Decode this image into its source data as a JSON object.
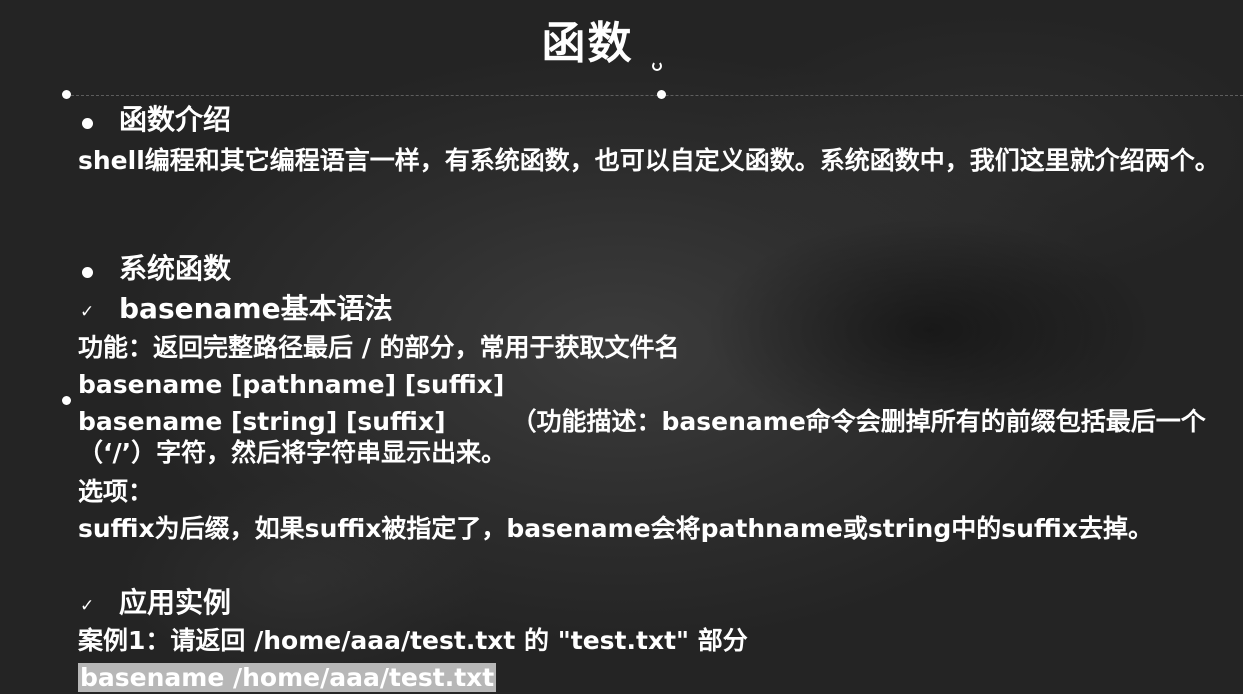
{
  "slide": {
    "title": "函数"
  },
  "sections": {
    "intro_heading": "函数介绍",
    "intro_text": "shell编程和其它编程语言一样，有系统函数，也可以自定义函数。系统函数中，我们这里就介绍两个。",
    "system_heading": "系统函数",
    "basename_heading": "basename基本语法",
    "function_desc": "功能：返回完整路径最后 / 的部分，常用于获取文件名",
    "syntax_1": "basename [pathname] [suffix]",
    "syntax_2": "basename [string] [suffix]",
    "syntax_2_note": "（功能描述：basename命令会删掉所有的前缀包括最后一个（‘/’）字符，然后将字符串显示出来。",
    "options_label": "选项：",
    "options_text": "suffix为后缀，如果suffix被指定了，basename会将pathname或string中的suffix去掉。",
    "example_heading": "应用实例",
    "case_1": "案例1：请返回 /home/aaa/test.txt 的 \"test.txt\" 部分",
    "command_1": "basename /home/aaa/test.txt"
  },
  "icons": {
    "bullet": "filled-circle",
    "check": "check-mark",
    "rotate": "rotate-handle-icon"
  },
  "colors": {
    "background": "#2e2e2e",
    "text": "#ffffff",
    "highlight": "#b7b7b7"
  }
}
